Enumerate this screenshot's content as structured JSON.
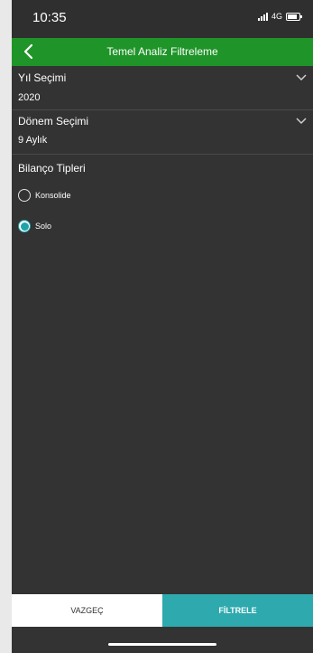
{
  "status_bar": {
    "time": "10:35",
    "network": "4G"
  },
  "header": {
    "title": "Temel Analiz Filtreleme"
  },
  "year": {
    "label": "Yıl Seçimi",
    "value": "2020"
  },
  "period": {
    "label": "Dönem Seçimi",
    "value": "9 Aylık"
  },
  "balance": {
    "label": "Bilanço Tipleri",
    "options": [
      {
        "label": "Konsolide",
        "selected": false
      },
      {
        "label": "Solo",
        "selected": true
      }
    ]
  },
  "actions": {
    "cancel": "VAZGEÇ",
    "filter": "FİLTRELE"
  },
  "colors": {
    "header": "#1f9428",
    "accent": "#2ea9ae",
    "background": "#333333"
  }
}
